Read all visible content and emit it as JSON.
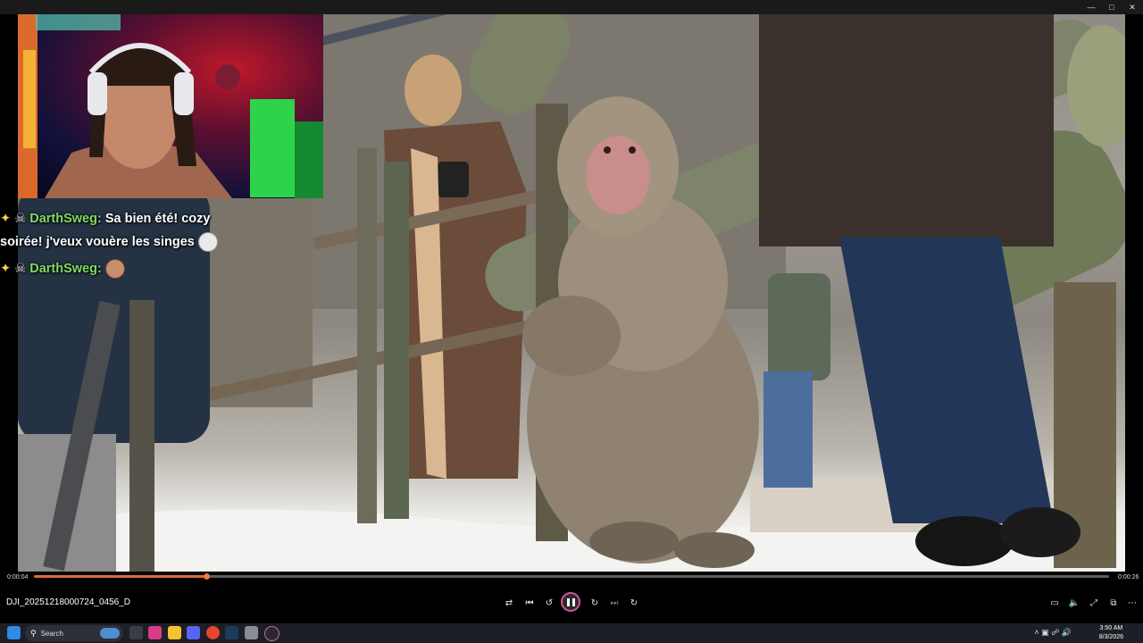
{
  "player": {
    "elapsed": "0:00:04",
    "duration": "0:00:26",
    "progress_fraction": 0.16,
    "filename": "DJI_20251218000724_0456_D",
    "accent_color": "#e06a32",
    "controls": [
      "shuffle-icon",
      "previous-icon",
      "replay-10-icon",
      "pause-icon",
      "forward-30-icon",
      "next-icon",
      "repeat-icon"
    ],
    "right_controls": [
      "cast-icon",
      "volume-icon",
      "fullscreen-icon",
      "miniplayer-icon",
      "more-icon"
    ]
  },
  "chat": {
    "line1_user": "DarthSweg:",
    "line1_msg": "Sa bien été! cozy",
    "line1_cont": "soirée! j'veux vouère les singes",
    "line2_user": "DarthSweg:",
    "username_color": "#7ddc62"
  },
  "taskbar": {
    "search_placeholder": "Search",
    "time": "3:50 AM",
    "date": "8/3/2026"
  }
}
